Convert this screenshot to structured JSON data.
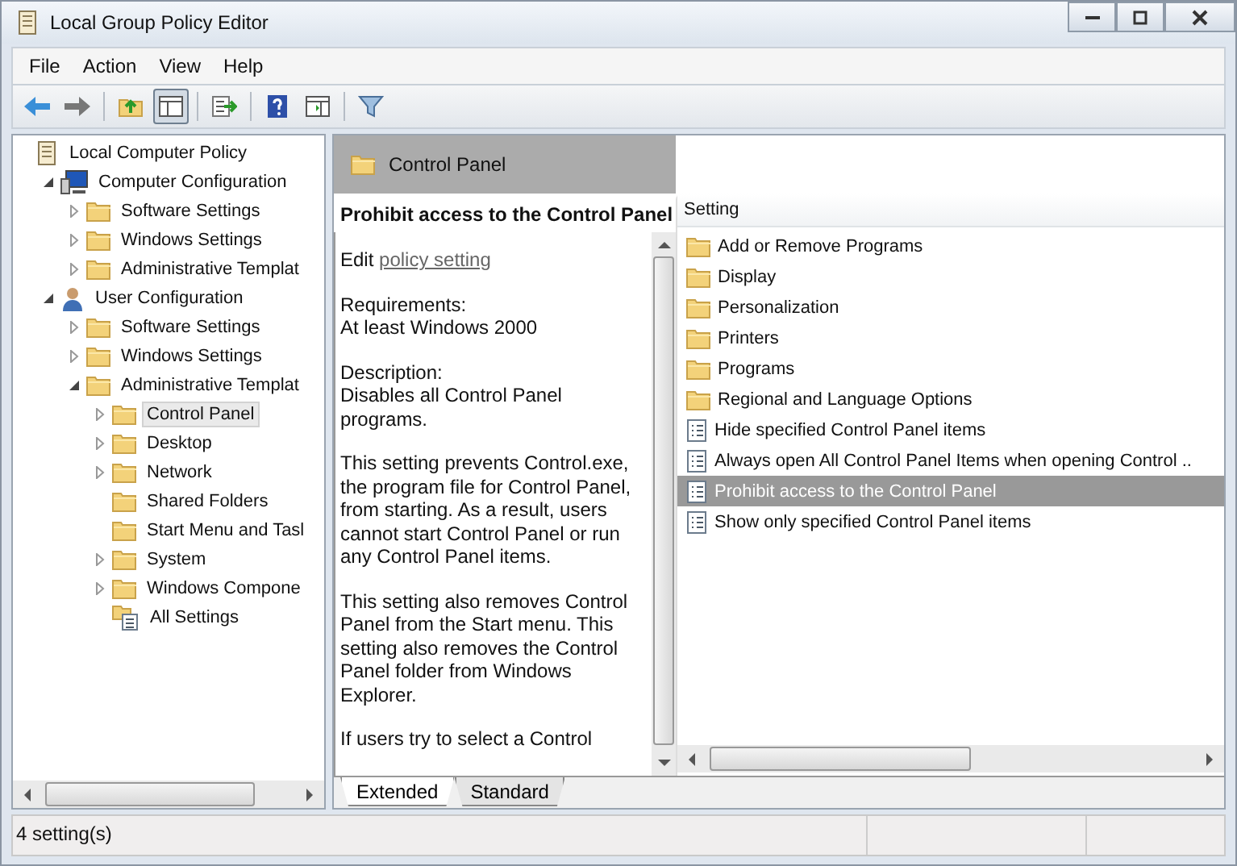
{
  "window": {
    "title": "Local Group Policy Editor"
  },
  "menu": [
    "File",
    "Action",
    "View",
    "Help"
  ],
  "toolbar": [
    {
      "kind": "back",
      "pressed": false
    },
    {
      "kind": "forward",
      "pressed": false
    },
    {
      "kind": "up",
      "pressed": false
    },
    {
      "kind": "tree",
      "pressed": true
    },
    {
      "kind": "export",
      "pressed": false
    },
    {
      "kind": "help",
      "pressed": false
    },
    {
      "kind": "panel",
      "pressed": false
    },
    {
      "kind": "filter",
      "pressed": false
    }
  ],
  "tree": [
    {
      "label": "Local Computer Policy",
      "kind": "policy",
      "expander": false,
      "selected": false,
      "children": [
        {
          "label": "Computer Configuration",
          "kind": "computer",
          "expander": true,
          "selected": false,
          "children": [
            {
              "label": "Software Settings",
              "kind": "folder",
              "expander": true,
              "selected": false
            },
            {
              "label": "Windows Settings",
              "kind": "folder",
              "expander": true,
              "selected": false
            },
            {
              "label": "Administrative Templat",
              "kind": "folder",
              "expander": true,
              "selected": false
            }
          ]
        },
        {
          "label": "User Configuration",
          "kind": "user",
          "expander": true,
          "selected": false,
          "children": [
            {
              "label": "Software Settings",
              "kind": "folder",
              "expander": true,
              "selected": false
            },
            {
              "label": "Windows Settings",
              "kind": "folder",
              "expander": true,
              "selected": false
            },
            {
              "label": "Administrative Templat",
              "kind": "folder",
              "expander": true,
              "selected": false,
              "children": [
                {
                  "label": "Control Panel",
                  "kind": "folder",
                  "expander": true,
                  "selected": true
                },
                {
                  "label": "Desktop",
                  "kind": "folder",
                  "expander": true,
                  "selected": false
                },
                {
                  "label": "Network",
                  "kind": "folder",
                  "expander": true,
                  "selected": false
                },
                {
                  "label": "Shared Folders",
                  "kind": "folder",
                  "expander": false,
                  "selected": false
                },
                {
                  "label": "Start Menu and Tasl",
                  "kind": "folder",
                  "expander": false,
                  "selected": false
                },
                {
                  "label": "System",
                  "kind": "folder",
                  "expander": true,
                  "selected": false
                },
                {
                  "label": "Windows Compone",
                  "kind": "folder",
                  "expander": true,
                  "selected": false
                },
                {
                  "label": "All Settings",
                  "kind": "settings",
                  "expander": false,
                  "selected": false
                }
              ]
            }
          ]
        }
      ]
    }
  ],
  "detail": {
    "header": "Control Panel",
    "title": "Prohibit access to the Control Panel",
    "edit_prefix": "Edit",
    "edit_link": "policy setting",
    "paragraphs": [
      [
        "Requirements:",
        "At least Windows 2000"
      ],
      [
        "Description:",
        "Disables all Control Panel programs."
      ],
      [
        "This setting prevents Control.exe, the program file for Control Panel, from starting. As a result, users cannot start Control Panel or run any Control Panel items."
      ],
      [
        "This setting also removes Control Panel from the Start menu. This setting also removes the Control Panel folder from Windows Explorer."
      ],
      [
        "If users try to select a Control"
      ]
    ]
  },
  "list": {
    "column": "Setting",
    "items": [
      {
        "label": "Add or Remove Programs",
        "kind": "folder",
        "selected": false
      },
      {
        "label": "Display",
        "kind": "folder",
        "selected": false
      },
      {
        "label": "Personalization",
        "kind": "folder",
        "selected": false
      },
      {
        "label": "Printers",
        "kind": "folder",
        "selected": false
      },
      {
        "label": "Programs",
        "kind": "folder",
        "selected": false
      },
      {
        "label": "Regional and Language Options",
        "kind": "folder",
        "selected": false
      },
      {
        "label": "Hide specified Control Panel items",
        "kind": "setting",
        "selected": false
      },
      {
        "label": "Always open All Control Panel Items when opening Control ..",
        "kind": "setting",
        "selected": false
      },
      {
        "label": "Prohibit access to the Control Panel",
        "kind": "setting",
        "selected": true
      },
      {
        "label": "Show only specified Control Panel items",
        "kind": "setting",
        "selected": false
      }
    ]
  },
  "tabs": [
    {
      "label": "Extended",
      "selected": true
    },
    {
      "label": "Standard",
      "selected": false
    }
  ],
  "status_bar": "4 setting(s)"
}
